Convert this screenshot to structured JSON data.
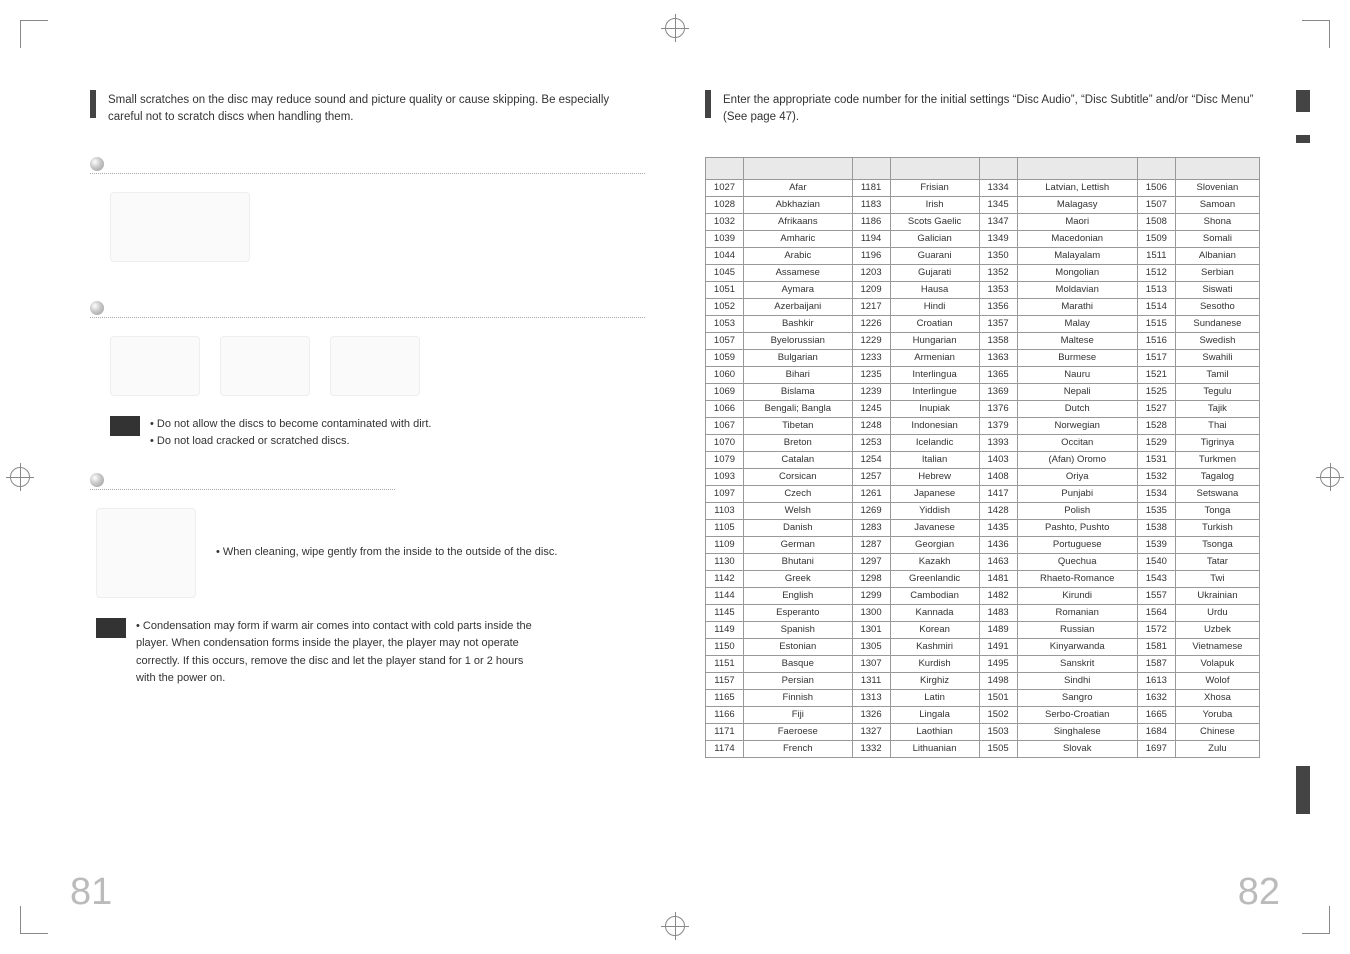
{
  "left_page": {
    "intro": "Small scratches on the disc may reduce sound and picture quality or cause skipping. Be especially careful not to scratch discs when handling them.",
    "sections": {
      "a": "",
      "b": "",
      "c": ""
    },
    "notes_b": [
      "• Do not allow the discs to become contaminated with dirt.",
      "• Do not load cracked or scratched discs."
    ],
    "notes_c_bullet": "• When cleaning, wipe gently from the inside to the outside of the disc.",
    "notes_c_cond": "• Condensation may form if warm air comes into contact with cold parts inside the player. When condensation forms inside the player, the player may not operate correctly. If this occurs, remove the disc and let the player stand for 1 or 2 hours with the power on.",
    "page_num": "81"
  },
  "right_page": {
    "intro": "Enter the appropriate code number for the initial settings “Disc Audio”, “Disc Subtitle” and/or “Disc Menu” (See page 47).",
    "page_num": "82",
    "table_headers": [
      "",
      "",
      "",
      "",
      "",
      "",
      "",
      ""
    ],
    "rows": [
      [
        "1027",
        "Afar",
        "1181",
        "Frisian",
        "1334",
        "Latvian, Lettish",
        "1506",
        "Slovenian"
      ],
      [
        "1028",
        "Abkhazian",
        "1183",
        "Irish",
        "1345",
        "Malagasy",
        "1507",
        "Samoan"
      ],
      [
        "1032",
        "Afrikaans",
        "1186",
        "Scots Gaelic",
        "1347",
        "Maori",
        "1508",
        "Shona"
      ],
      [
        "1039",
        "Amharic",
        "1194",
        "Galician",
        "1349",
        "Macedonian",
        "1509",
        "Somali"
      ],
      [
        "1044",
        "Arabic",
        "1196",
        "Guarani",
        "1350",
        "Malayalam",
        "1511",
        "Albanian"
      ],
      [
        "1045",
        "Assamese",
        "1203",
        "Gujarati",
        "1352",
        "Mongolian",
        "1512",
        "Serbian"
      ],
      [
        "1051",
        "Aymara",
        "1209",
        "Hausa",
        "1353",
        "Moldavian",
        "1513",
        "Siswati"
      ],
      [
        "1052",
        "Azerbaijani",
        "1217",
        "Hindi",
        "1356",
        "Marathi",
        "1514",
        "Sesotho"
      ],
      [
        "1053",
        "Bashkir",
        "1226",
        "Croatian",
        "1357",
        "Malay",
        "1515",
        "Sundanese"
      ],
      [
        "1057",
        "Byelorussian",
        "1229",
        "Hungarian",
        "1358",
        "Maltese",
        "1516",
        "Swedish"
      ],
      [
        "1059",
        "Bulgarian",
        "1233",
        "Armenian",
        "1363",
        "Burmese",
        "1517",
        "Swahili"
      ],
      [
        "1060",
        "Bihari",
        "1235",
        "Interlingua",
        "1365",
        "Nauru",
        "1521",
        "Tamil"
      ],
      [
        "1069",
        "Bislama",
        "1239",
        "Interlingue",
        "1369",
        "Nepali",
        "1525",
        "Tegulu"
      ],
      [
        "1066",
        "Bengali; Bangla",
        "1245",
        "Inupiak",
        "1376",
        "Dutch",
        "1527",
        "Tajik"
      ],
      [
        "1067",
        "Tibetan",
        "1248",
        "Indonesian",
        "1379",
        "Norwegian",
        "1528",
        "Thai"
      ],
      [
        "1070",
        "Breton",
        "1253",
        "Icelandic",
        "1393",
        "Occitan",
        "1529",
        "Tigrinya"
      ],
      [
        "1079",
        "Catalan",
        "1254",
        "Italian",
        "1403",
        "(Afan) Oromo",
        "1531",
        "Turkmen"
      ],
      [
        "1093",
        "Corsican",
        "1257",
        "Hebrew",
        "1408",
        "Oriya",
        "1532",
        "Tagalog"
      ],
      [
        "1097",
        "Czech",
        "1261",
        "Japanese",
        "1417",
        "Punjabi",
        "1534",
        "Setswana"
      ],
      [
        "1103",
        "Welsh",
        "1269",
        "Yiddish",
        "1428",
        "Polish",
        "1535",
        "Tonga"
      ],
      [
        "1105",
        "Danish",
        "1283",
        "Javanese",
        "1435",
        "Pashto, Pushto",
        "1538",
        "Turkish"
      ],
      [
        "1109",
        "German",
        "1287",
        "Georgian",
        "1436",
        "Portuguese",
        "1539",
        "Tsonga"
      ],
      [
        "1130",
        "Bhutani",
        "1297",
        "Kazakh",
        "1463",
        "Quechua",
        "1540",
        "Tatar"
      ],
      [
        "1142",
        "Greek",
        "1298",
        "Greenlandic",
        "1481",
        "Rhaeto-Romance",
        "1543",
        "Twi"
      ],
      [
        "1144",
        "English",
        "1299",
        "Cambodian",
        "1482",
        "Kirundi",
        "1557",
        "Ukrainian"
      ],
      [
        "1145",
        "Esperanto",
        "1300",
        "Kannada",
        "1483",
        "Romanian",
        "1564",
        "Urdu"
      ],
      [
        "1149",
        "Spanish",
        "1301",
        "Korean",
        "1489",
        "Russian",
        "1572",
        "Uzbek"
      ],
      [
        "1150",
        "Estonian",
        "1305",
        "Kashmiri",
        "1491",
        "Kinyarwanda",
        "1581",
        "Vietnamese"
      ],
      [
        "1151",
        "Basque",
        "1307",
        "Kurdish",
        "1495",
        "Sanskrit",
        "1587",
        "Volapuk"
      ],
      [
        "1157",
        "Persian",
        "1311",
        "Kirghiz",
        "1498",
        "Sindhi",
        "1613",
        "Wolof"
      ],
      [
        "1165",
        "Finnish",
        "1313",
        "Latin",
        "1501",
        "Sangro",
        "1632",
        "Xhosa"
      ],
      [
        "1166",
        "Fiji",
        "1326",
        "Lingala",
        "1502",
        "Serbo-Croatian",
        "1665",
        "Yoruba"
      ],
      [
        "1171",
        "Faeroese",
        "1327",
        "Laothian",
        "1503",
        "Singhalese",
        "1684",
        "Chinese"
      ],
      [
        "1174",
        "French",
        "1332",
        "Lithuanian",
        "1505",
        "Slovak",
        "1697",
        "Zulu"
      ]
    ]
  }
}
